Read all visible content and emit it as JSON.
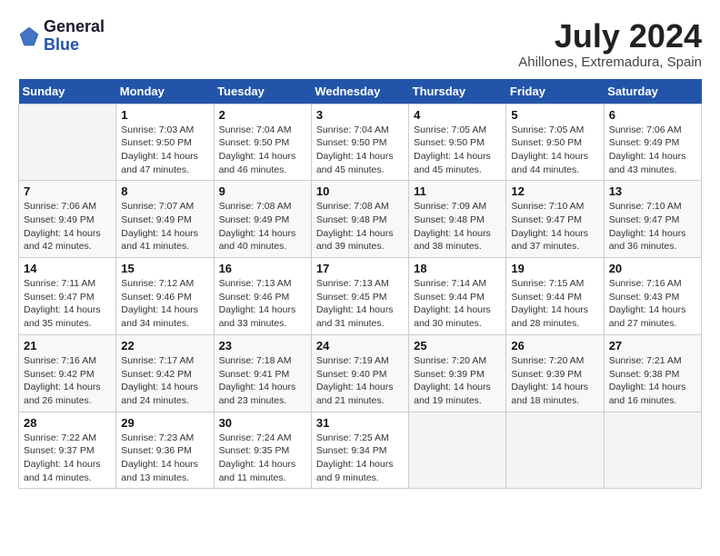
{
  "header": {
    "logo_general": "General",
    "logo_blue": "Blue",
    "month_year": "July 2024",
    "location": "Ahillones, Extremadura, Spain"
  },
  "days_of_week": [
    "Sunday",
    "Monday",
    "Tuesday",
    "Wednesday",
    "Thursday",
    "Friday",
    "Saturday"
  ],
  "weeks": [
    [
      {
        "day": "",
        "info": ""
      },
      {
        "day": "1",
        "info": "Sunrise: 7:03 AM\nSunset: 9:50 PM\nDaylight: 14 hours\nand 47 minutes."
      },
      {
        "day": "2",
        "info": "Sunrise: 7:04 AM\nSunset: 9:50 PM\nDaylight: 14 hours\nand 46 minutes."
      },
      {
        "day": "3",
        "info": "Sunrise: 7:04 AM\nSunset: 9:50 PM\nDaylight: 14 hours\nand 45 minutes."
      },
      {
        "day": "4",
        "info": "Sunrise: 7:05 AM\nSunset: 9:50 PM\nDaylight: 14 hours\nand 45 minutes."
      },
      {
        "day": "5",
        "info": "Sunrise: 7:05 AM\nSunset: 9:50 PM\nDaylight: 14 hours\nand 44 minutes."
      },
      {
        "day": "6",
        "info": "Sunrise: 7:06 AM\nSunset: 9:49 PM\nDaylight: 14 hours\nand 43 minutes."
      }
    ],
    [
      {
        "day": "7",
        "info": "Sunrise: 7:06 AM\nSunset: 9:49 PM\nDaylight: 14 hours\nand 42 minutes."
      },
      {
        "day": "8",
        "info": "Sunrise: 7:07 AM\nSunset: 9:49 PM\nDaylight: 14 hours\nand 41 minutes."
      },
      {
        "day": "9",
        "info": "Sunrise: 7:08 AM\nSunset: 9:49 PM\nDaylight: 14 hours\nand 40 minutes."
      },
      {
        "day": "10",
        "info": "Sunrise: 7:08 AM\nSunset: 9:48 PM\nDaylight: 14 hours\nand 39 minutes."
      },
      {
        "day": "11",
        "info": "Sunrise: 7:09 AM\nSunset: 9:48 PM\nDaylight: 14 hours\nand 38 minutes."
      },
      {
        "day": "12",
        "info": "Sunrise: 7:10 AM\nSunset: 9:47 PM\nDaylight: 14 hours\nand 37 minutes."
      },
      {
        "day": "13",
        "info": "Sunrise: 7:10 AM\nSunset: 9:47 PM\nDaylight: 14 hours\nand 36 minutes."
      }
    ],
    [
      {
        "day": "14",
        "info": "Sunrise: 7:11 AM\nSunset: 9:47 PM\nDaylight: 14 hours\nand 35 minutes."
      },
      {
        "day": "15",
        "info": "Sunrise: 7:12 AM\nSunset: 9:46 PM\nDaylight: 14 hours\nand 34 minutes."
      },
      {
        "day": "16",
        "info": "Sunrise: 7:13 AM\nSunset: 9:46 PM\nDaylight: 14 hours\nand 33 minutes."
      },
      {
        "day": "17",
        "info": "Sunrise: 7:13 AM\nSunset: 9:45 PM\nDaylight: 14 hours\nand 31 minutes."
      },
      {
        "day": "18",
        "info": "Sunrise: 7:14 AM\nSunset: 9:44 PM\nDaylight: 14 hours\nand 30 minutes."
      },
      {
        "day": "19",
        "info": "Sunrise: 7:15 AM\nSunset: 9:44 PM\nDaylight: 14 hours\nand 28 minutes."
      },
      {
        "day": "20",
        "info": "Sunrise: 7:16 AM\nSunset: 9:43 PM\nDaylight: 14 hours\nand 27 minutes."
      }
    ],
    [
      {
        "day": "21",
        "info": "Sunrise: 7:16 AM\nSunset: 9:42 PM\nDaylight: 14 hours\nand 26 minutes."
      },
      {
        "day": "22",
        "info": "Sunrise: 7:17 AM\nSunset: 9:42 PM\nDaylight: 14 hours\nand 24 minutes."
      },
      {
        "day": "23",
        "info": "Sunrise: 7:18 AM\nSunset: 9:41 PM\nDaylight: 14 hours\nand 23 minutes."
      },
      {
        "day": "24",
        "info": "Sunrise: 7:19 AM\nSunset: 9:40 PM\nDaylight: 14 hours\nand 21 minutes."
      },
      {
        "day": "25",
        "info": "Sunrise: 7:20 AM\nSunset: 9:39 PM\nDaylight: 14 hours\nand 19 minutes."
      },
      {
        "day": "26",
        "info": "Sunrise: 7:20 AM\nSunset: 9:39 PM\nDaylight: 14 hours\nand 18 minutes."
      },
      {
        "day": "27",
        "info": "Sunrise: 7:21 AM\nSunset: 9:38 PM\nDaylight: 14 hours\nand 16 minutes."
      }
    ],
    [
      {
        "day": "28",
        "info": "Sunrise: 7:22 AM\nSunset: 9:37 PM\nDaylight: 14 hours\nand 14 minutes."
      },
      {
        "day": "29",
        "info": "Sunrise: 7:23 AM\nSunset: 9:36 PM\nDaylight: 14 hours\nand 13 minutes."
      },
      {
        "day": "30",
        "info": "Sunrise: 7:24 AM\nSunset: 9:35 PM\nDaylight: 14 hours\nand 11 minutes."
      },
      {
        "day": "31",
        "info": "Sunrise: 7:25 AM\nSunset: 9:34 PM\nDaylight: 14 hours\nand 9 minutes."
      },
      {
        "day": "",
        "info": ""
      },
      {
        "day": "",
        "info": ""
      },
      {
        "day": "",
        "info": ""
      }
    ]
  ]
}
